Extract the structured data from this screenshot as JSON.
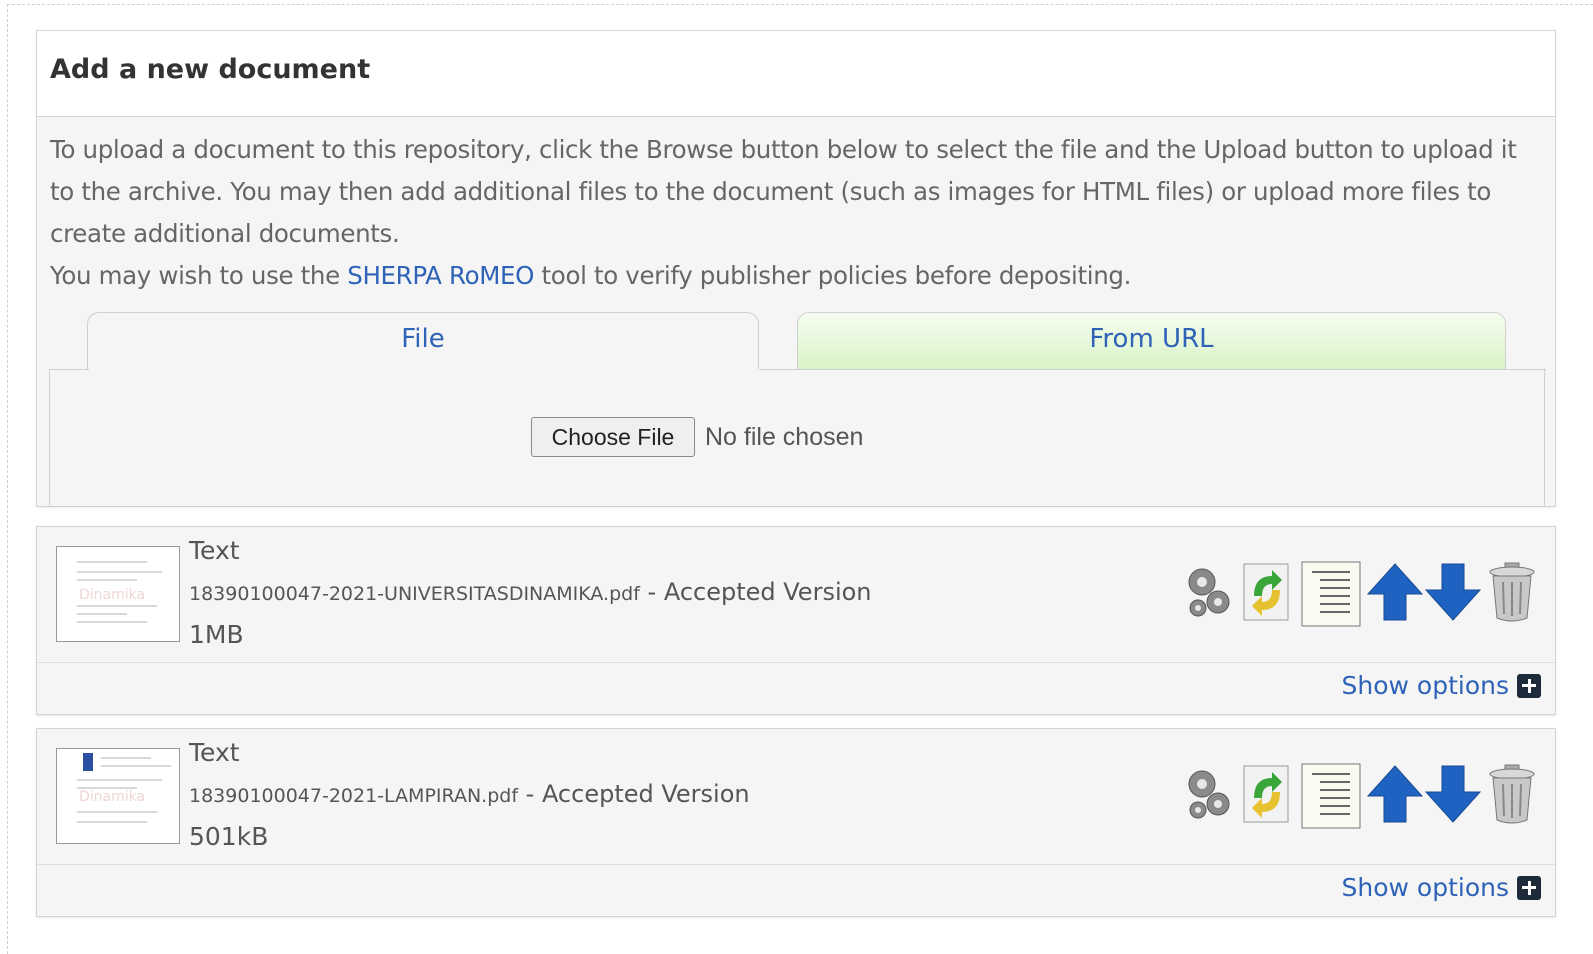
{
  "panel": {
    "title": "Add a new document",
    "intro_line1": "To upload a document to this repository, click the Browse button below to select the file and the Upload button to upload it to the archive. You may then add additional files to the document (such as images for HTML files) or upload more files to create additional documents.",
    "intro_line2_before": "You may wish to use the ",
    "intro_link": "SHERPA RoMEO",
    "intro_line2_after": " tool to verify publisher policies before depositing."
  },
  "tabs": [
    {
      "label": "File",
      "active": true
    },
    {
      "label": "From URL",
      "active": false
    }
  ],
  "upload": {
    "button_label": "Choose File",
    "status": "No file chosen"
  },
  "documents": [
    {
      "type": "Text",
      "filename": "18390100047-2021-UNIVERSITASDINAMIKA.pdf",
      "separator": " - ",
      "version": "Accepted Version",
      "size": "1MB",
      "show_options": "Show options"
    },
    {
      "type": "Text",
      "filename": "18390100047-2021-LAMPIRAN.pdf",
      "separator": " - ",
      "version": "Accepted Version",
      "size": "501kB",
      "show_options": "Show options"
    }
  ],
  "icons": {
    "settings": "gears-icon",
    "convert": "convert-document-icon",
    "details": "document-lines-icon",
    "move_up": "arrow-up-icon",
    "move_down": "arrow-down-icon",
    "delete": "trash-icon",
    "expand": "plus-box-icon"
  },
  "colors": {
    "link": "#2e63b8",
    "tab_url_bg": "#d9f3c8",
    "arrow": "#1f63c2"
  }
}
